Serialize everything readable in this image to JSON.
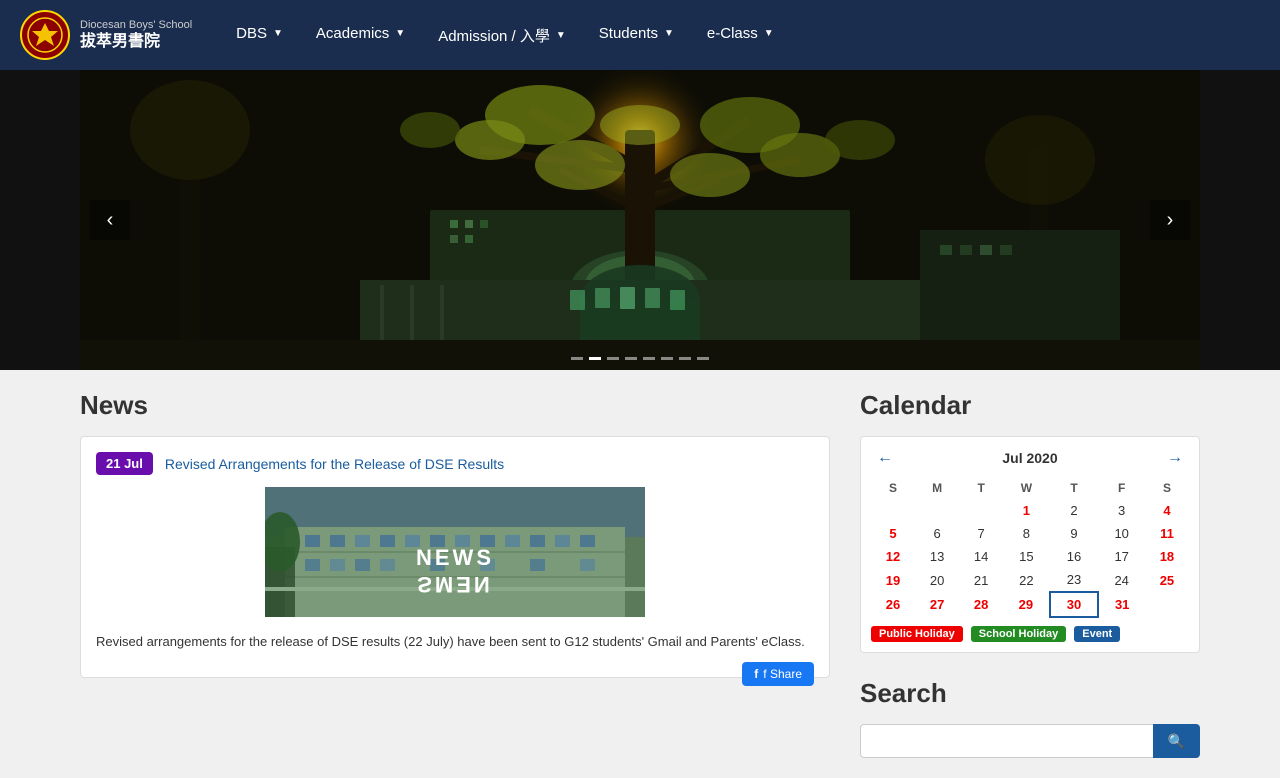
{
  "school": {
    "name_eng": "Diocesan Boys' School",
    "name_chi": "拔萃男書院",
    "logo_text": "✦"
  },
  "nav": {
    "links": [
      {
        "id": "dbs",
        "label": "DBS",
        "has_dropdown": true
      },
      {
        "id": "academics",
        "label": "Academics",
        "has_dropdown": true
      },
      {
        "id": "admission",
        "label": "Admission / 入學",
        "has_dropdown": true
      },
      {
        "id": "students",
        "label": "Students",
        "has_dropdown": true
      },
      {
        "id": "eclass",
        "label": "e-Class",
        "has_dropdown": true
      }
    ]
  },
  "carousel": {
    "prev_label": "‹",
    "next_label": "›",
    "dots": 8,
    "active_dot": 2
  },
  "news": {
    "section_title": "News",
    "items": [
      {
        "date": "21 Jul",
        "title": "Revised Arrangements for the Release of DSE Results",
        "link": "#",
        "body": "Revised arrangements for the release of DSE results (22 July) have been sent to G12 students' Gmail and Parents' eClass.",
        "image_line1": "NEWS",
        "image_line2": "SMƎN"
      }
    ],
    "fb_share_label": "f Share"
  },
  "calendar": {
    "section_title": "Calendar",
    "month_title": "Jul 2020",
    "prev_label": "←",
    "next_label": "→",
    "headers": [
      "S",
      "M",
      "T",
      "W",
      "T",
      "F",
      "S"
    ],
    "weeks": [
      [
        null,
        null,
        null,
        1,
        2,
        3,
        4
      ],
      [
        5,
        6,
        7,
        8,
        9,
        10,
        11
      ],
      [
        12,
        13,
        14,
        15,
        16,
        17,
        18
      ],
      [
        19,
        20,
        21,
        22,
        23,
        24,
        25
      ],
      [
        26,
        27,
        28,
        29,
        30,
        31,
        null
      ]
    ],
    "today": 30,
    "red_dates": [
      1,
      5,
      12,
      19,
      26,
      27,
      28,
      29,
      30,
      31
    ],
    "legend": [
      {
        "label": "Public Holiday",
        "class": "legend-public"
      },
      {
        "label": "School Holiday",
        "class": "legend-school"
      },
      {
        "label": "Event",
        "class": "legend-event"
      }
    ]
  },
  "search": {
    "section_title": "Search",
    "input_placeholder": "",
    "button_icon": "🔍"
  }
}
